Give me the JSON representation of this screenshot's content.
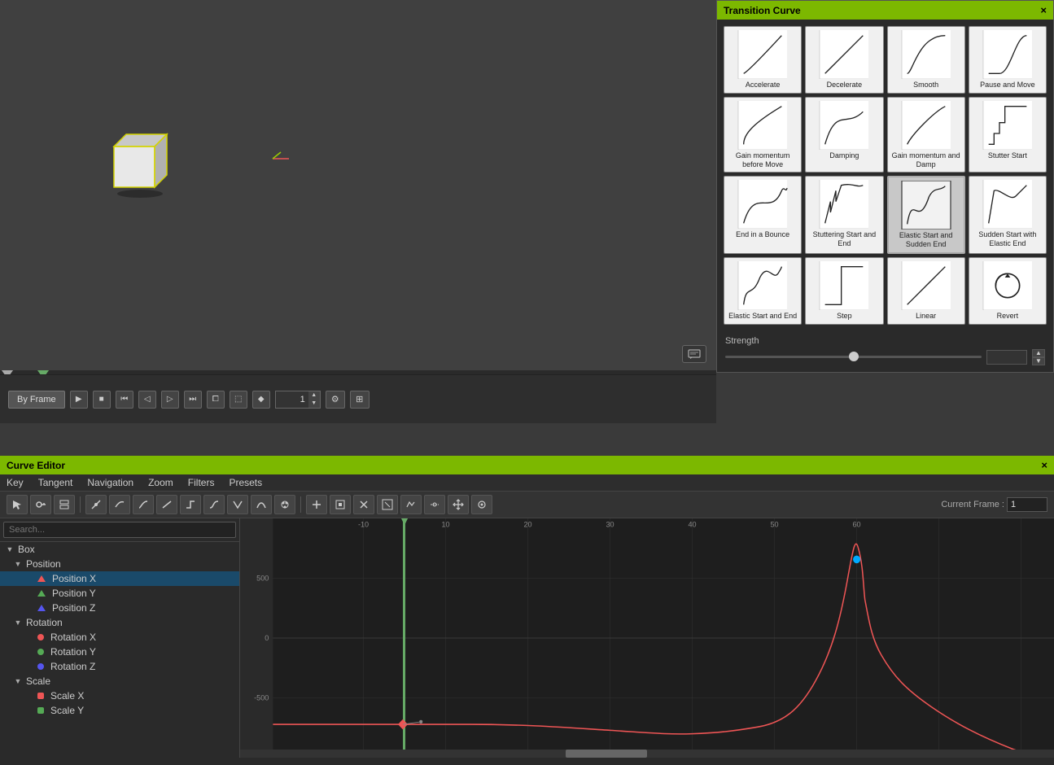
{
  "viewport": {
    "background_color": "#404040"
  },
  "transition_panel": {
    "title": "Transition Curve",
    "close_label": "×",
    "curves": [
      {
        "id": "accelerate",
        "label": "Accelerate",
        "selected": false,
        "curve_type": "accelerate"
      },
      {
        "id": "decelerate",
        "label": "Decelerate",
        "selected": false,
        "curve_type": "decelerate"
      },
      {
        "id": "smooth",
        "label": "Smooth",
        "selected": false,
        "curve_type": "smooth"
      },
      {
        "id": "pause-and-move",
        "label": "Pause and Move",
        "selected": false,
        "curve_type": "pause_move"
      },
      {
        "id": "gain-momentum-before-move",
        "label": "Gain momentum before Move",
        "selected": false,
        "curve_type": "gain_momentum"
      },
      {
        "id": "damping",
        "label": "Damping",
        "selected": false,
        "curve_type": "damping"
      },
      {
        "id": "gain-momentum-and-damp",
        "label": "Gain momentum and Damp",
        "selected": false,
        "curve_type": "gain_damp"
      },
      {
        "id": "stutter-start",
        "label": "Stutter Start",
        "selected": false,
        "curve_type": "stutter_start"
      },
      {
        "id": "end-in-a-bounce",
        "label": "End in a Bounce",
        "selected": false,
        "curve_type": "end_bounce"
      },
      {
        "id": "stuttering-start-and-end",
        "label": "Stuttering Start and End",
        "selected": false,
        "curve_type": "stutter_end"
      },
      {
        "id": "elastic-start-and-sudden-end",
        "label": "Elastic Start and Sudden End",
        "selected": true,
        "curve_type": "elastic_sudden"
      },
      {
        "id": "sudden-start-with-elastic-end",
        "label": "Sudden Start with Elastic End",
        "selected": false,
        "curve_type": "sudden_elastic"
      },
      {
        "id": "elastic-start-and-end",
        "label": "Elastic Start and End",
        "selected": false,
        "curve_type": "elastic_both"
      },
      {
        "id": "step",
        "label": "Step",
        "selected": false,
        "curve_type": "step"
      },
      {
        "id": "linear",
        "label": "Linear",
        "selected": false,
        "curve_type": "linear"
      },
      {
        "id": "revert",
        "label": "Revert",
        "selected": false,
        "curve_type": "revert"
      }
    ],
    "strength": {
      "label": "Strength",
      "value": ""
    }
  },
  "timeline_controls": {
    "by_frame_label": "By Frame",
    "frame_value": "1",
    "transport": {
      "play": "▶",
      "stop": "■",
      "to_start": "⏮",
      "prev_frame": "◀",
      "next_frame": "▶",
      "to_end": "⏭"
    }
  },
  "curve_editor": {
    "title": "Curve Editor",
    "close_label": "×",
    "menu_items": [
      "Key",
      "Tangent",
      "Navigation",
      "Zoom",
      "Filters",
      "Presets"
    ],
    "current_frame_label": "Current Frame :",
    "current_frame_value": "1",
    "scene_tree": {
      "search_placeholder": "Search...",
      "items": [
        {
          "id": "box",
          "label": "Box",
          "level": 0,
          "type": "parent",
          "expanded": true
        },
        {
          "id": "position",
          "label": "Position",
          "level": 1,
          "type": "parent",
          "expanded": true
        },
        {
          "id": "position-x",
          "label": "Position X",
          "level": 2,
          "type": "leaf",
          "color": "red",
          "selected": true
        },
        {
          "id": "position-y",
          "label": "Position Y",
          "level": 2,
          "type": "leaf",
          "color": "green",
          "selected": false
        },
        {
          "id": "position-z",
          "label": "Position Z",
          "level": 2,
          "type": "leaf",
          "color": "blue",
          "selected": false
        },
        {
          "id": "rotation",
          "label": "Rotation",
          "level": 1,
          "type": "parent",
          "expanded": true
        },
        {
          "id": "rotation-x",
          "label": "Rotation X",
          "level": 2,
          "type": "leaf",
          "color": "red",
          "selected": false
        },
        {
          "id": "rotation-y",
          "label": "Rotation Y",
          "level": 2,
          "type": "leaf",
          "color": "green",
          "selected": false
        },
        {
          "id": "rotation-z",
          "label": "Rotation Z",
          "level": 2,
          "type": "leaf",
          "color": "blue",
          "selected": false
        },
        {
          "id": "scale",
          "label": "Scale",
          "level": 1,
          "type": "parent",
          "expanded": true
        },
        {
          "id": "scale-x",
          "label": "Scale X",
          "level": 2,
          "type": "leaf",
          "color": "red_sq",
          "selected": false
        },
        {
          "id": "scale-y",
          "label": "Scale Y",
          "level": 2,
          "type": "leaf",
          "color": "green_sq",
          "selected": false
        }
      ]
    },
    "graph": {
      "value_500": "500",
      "value_0": "0",
      "value_neg500": "-500",
      "frame_markers": [
        "-10",
        "10",
        "20",
        "30",
        "40",
        "50",
        "60"
      ]
    }
  }
}
